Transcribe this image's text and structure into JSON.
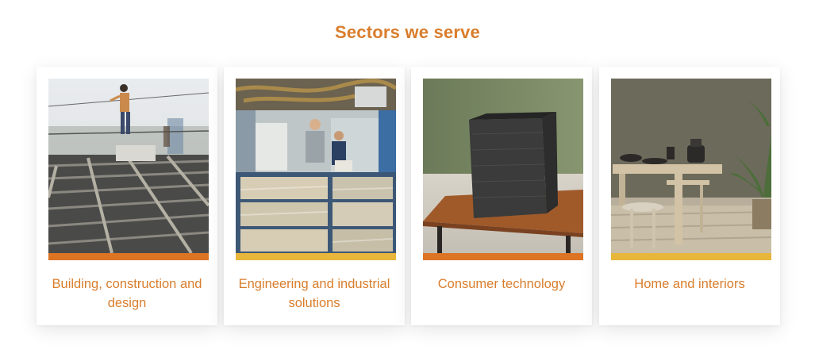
{
  "section": {
    "title": "Sectors we serve"
  },
  "colors": {
    "accent": "#d97d2c",
    "bar_orange": "#dc7424",
    "bar_yellow": "#e8b63a"
  },
  "sectors": [
    {
      "label": "Building, construction and design",
      "image": "construction-rebar-image",
      "bar": "orange"
    },
    {
      "label": "Engineering and industrial solutions",
      "image": "factory-engineers-image",
      "bar": "yellow"
    },
    {
      "label": "Consumer technology",
      "image": "smart-speaker-image",
      "bar": "orange"
    },
    {
      "label": "Home and interiors",
      "image": "dining-interior-image",
      "bar": "yellow"
    }
  ]
}
